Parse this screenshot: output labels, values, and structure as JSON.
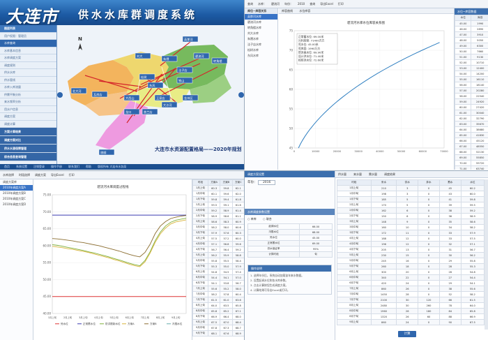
{
  "q1": {
    "brand": "大连市",
    "system_title": "供水水库群调度系统",
    "sidebar": [
      {
        "label": "图层列表",
        "kind": "hd"
      },
      {
        "label": "用户权限：管理员",
        "kind": ""
      },
      {
        "label": "水库查询",
        "kind": "act"
      },
      {
        "label": "水库基本信息",
        "kind": ""
      },
      {
        "label": "水库调度方案",
        "kind": ""
      },
      {
        "label": "调度规则",
        "kind": ""
      },
      {
        "label": "供水水库",
        "kind": ""
      },
      {
        "label": "供水管线",
        "kind": ""
      },
      {
        "label": "水库入库流量",
        "kind": ""
      },
      {
        "label": "供需平衡分析",
        "kind": ""
      },
      {
        "label": "来水频率分析",
        "kind": ""
      },
      {
        "label": "用水户信息",
        "kind": ""
      },
      {
        "label": "调度方案",
        "kind": ""
      },
      {
        "label": "调度计算",
        "kind": ""
      },
      {
        "label": "方案计算结果",
        "kind": "grp"
      },
      {
        "label": "调度方案对比",
        "kind": "grp"
      },
      {
        "label": "供水水源保障管理",
        "kind": "grp"
      },
      {
        "label": "综合信息查询管理",
        "kind": "grp"
      }
    ],
    "map_labels": [
      {
        "name": "英那河",
        "k": "a"
      },
      {
        "name": "碧流河",
        "k": "b"
      },
      {
        "name": "转角楼",
        "k": "c"
      },
      {
        "name": "朱隈",
        "k": "d"
      },
      {
        "name": "刘大",
        "k": "e"
      },
      {
        "name": "洼子店",
        "k": "f"
      },
      {
        "name": "松树",
        "k": "g"
      },
      {
        "name": "东风",
        "k": "h"
      },
      {
        "name": "铁山",
        "k": "i"
      },
      {
        "name": "大西山",
        "k": "j"
      },
      {
        "name": "王家店",
        "k": "k"
      },
      {
        "name": "金州区",
        "k": "l"
      },
      {
        "name": "旅顺",
        "k": "m"
      },
      {
        "name": "普兰店",
        "k": "n"
      },
      {
        "name": "大沙河",
        "k": "o"
      },
      {
        "name": "北大河",
        "k": "p"
      },
      {
        "name": "瓦房店",
        "k": "q"
      },
      {
        "name": "龙口",
        "k": "r"
      }
    ],
    "map_caption": "大连市水资源配置格局——2020年规划",
    "compass": "N",
    "status_items": [
      "首页",
      "系统设置",
      "注销登录",
      "操作手册",
      "联系我们",
      "帮助",
      "版权所有 大连市水务局"
    ]
  },
  "q2": {
    "toolbar": [
      "查询",
      "水库：",
      "碧流河",
      "年份：",
      "2010",
      "查询",
      "导出Excel",
      "打印"
    ],
    "tree_title": "库位~库容关系",
    "tree_items": [
      "英那河水库",
      "碧流河水库",
      "转角楼水库",
      "刘大水库",
      "朱隈水库",
      "洼子店水库",
      "松树水库",
      "东风水库"
    ],
    "tabs": [
      "库容曲线",
      "水位库容"
    ],
    "chart_title": "碧流河水库水位库容关系图",
    "legend_lines": [
      "正常蓄水位: 69.00米",
      "兴利库容: 71400万方",
      "死水位: 45.00米",
      "死库容: 1990万方",
      "防洪高水位: 69.90米",
      "设计洪水位: 71.40米",
      "校核洪水位: 72.60米"
    ],
    "table_title": "水位~库容数据",
    "table_headers": [
      "水位",
      "库容"
    ],
    "table_rows": [
      [
        "45.00",
        "1990"
      ],
      [
        "46.00",
        "2890"
      ],
      [
        "47.00",
        "3910"
      ],
      [
        "48.00",
        "5050"
      ],
      [
        "49.00",
        "6300"
      ],
      [
        "50.00",
        "7660"
      ],
      [
        "51.00",
        "9130"
      ],
      [
        "52.00",
        "10710"
      ],
      [
        "53.00",
        "12400"
      ],
      [
        "54.00",
        "14200"
      ],
      [
        "55.00",
        "16110"
      ],
      [
        "56.00",
        "18140"
      ],
      [
        "57.00",
        "20280"
      ],
      [
        "58.00",
        "22540"
      ],
      [
        "59.00",
        "24920"
      ],
      [
        "60.00",
        "27420"
      ],
      [
        "61.00",
        "30040"
      ],
      [
        "62.00",
        "32790"
      ],
      [
        "63.00",
        "35670"
      ],
      [
        "64.00",
        "38680"
      ],
      [
        "65.00",
        "41830"
      ],
      [
        "66.00",
        "45120"
      ],
      [
        "67.00",
        "48550"
      ],
      [
        "68.00",
        "52130"
      ],
      [
        "69.00",
        "55850"
      ],
      [
        "70.00",
        "59720"
      ],
      [
        "71.00",
        "63740"
      ],
      [
        "72.00",
        "67910"
      ]
    ]
  },
  "q3": {
    "toolbar": [
      "水库选择",
      "时段选择",
      "调度方案",
      "导出Excel",
      "打印"
    ],
    "tree_items": [
      "调度方案库",
      "2010年调度方案A",
      "2010年调度方案B",
      "2010年调度方案C",
      "2010年调度方案D"
    ],
    "chart_title": "碧流河水库调度过程线",
    "legend": [
      "死水位",
      "正常蓄水位",
      "防洪限制水位",
      "方案A",
      "方案B",
      "汛限水位"
    ],
    "table_headers": [
      "时段",
      "方案A",
      "方案B",
      "方案C"
    ],
    "table_rows": [
      [
        "1月上旬",
        "60.3",
        "59.8",
        "62.1"
      ],
      [
        "1月中旬",
        "60.1",
        "59.6",
        "62.0"
      ],
      [
        "1月下旬",
        "59.8",
        "59.4",
        "61.8"
      ],
      [
        "2月上旬",
        "59.5",
        "59.1",
        "61.6"
      ],
      [
        "2月中旬",
        "59.2",
        "58.9",
        "61.4"
      ],
      [
        "2月下旬",
        "58.9",
        "58.6",
        "61.1"
      ],
      [
        "3月上旬",
        "58.6",
        "58.3",
        "60.9"
      ],
      [
        "3月中旬",
        "58.2",
        "58.0",
        "60.6"
      ],
      [
        "3月下旬",
        "57.9",
        "57.6",
        "60.3"
      ],
      [
        "4月上旬",
        "57.5",
        "57.2",
        "60.0"
      ],
      [
        "4月中旬",
        "57.1",
        "56.8",
        "59.6"
      ],
      [
        "4月下旬",
        "56.7",
        "56.4",
        "59.2"
      ],
      [
        "5月上旬",
        "56.2",
        "55.9",
        "58.8"
      ],
      [
        "5月中旬",
        "55.8",
        "55.5",
        "58.4"
      ],
      [
        "5月下旬",
        "55.3",
        "55.0",
        "57.9"
      ],
      [
        "6月上旬",
        "54.8",
        "54.5",
        "57.4"
      ],
      [
        "6月中旬",
        "54.4",
        "54.1",
        "57.0"
      ],
      [
        "6月下旬",
        "54.1",
        "53.8",
        "56.7"
      ],
      [
        "7月上旬",
        "55.6",
        "55.2",
        "58.0"
      ],
      [
        "7月中旬",
        "58.2",
        "57.8",
        "60.4"
      ],
      [
        "7月下旬",
        "61.5",
        "61.0",
        "63.6"
      ],
      [
        "8月上旬",
        "64.0",
        "63.5",
        "65.8"
      ],
      [
        "8月中旬",
        "65.8",
        "65.2",
        "67.1"
      ],
      [
        "8月下旬",
        "66.9",
        "66.4",
        "68.0"
      ],
      [
        "9月上旬",
        "67.5",
        "67.0",
        "68.4"
      ],
      [
        "9月中旬",
        "67.8",
        "67.3",
        "68.7"
      ],
      [
        "9月下旬",
        "68.1",
        "67.6",
        "68.9"
      ]
    ]
  },
  "q4": {
    "tabs": [
      "供水量",
      "来水量",
      "需水量",
      "调度结果"
    ],
    "panel_title": "调度方案设置",
    "year_label": "年份：",
    "year_value": "2016",
    "section_title": "水库调度参数设置",
    "options": [
      "单库",
      "联合"
    ],
    "params": [
      [
        "起调水位",
        "66.00"
      ],
      [
        "汛限水位",
        "68.00"
      ],
      [
        "死水位",
        "45.00"
      ],
      [
        "正常蓄水位",
        "69.00"
      ],
      [
        "供水保证率",
        "95%"
      ],
      [
        "计算时段",
        "旬"
      ]
    ],
    "note_title": "操作说明",
    "notes": [
      "1. 选择年份后，系统自动加载该年来水数据。",
      "2. 设置起调水位和各水库参数。",
      "3. 点击计算按钮生成调度方案。",
      "4. 计算结果可导出Excel或打印。"
    ],
    "table_headers": [
      "时段",
      "来水",
      "供水",
      "弃水",
      "蓄水",
      "水位"
    ],
    "table_rows": [
      [
        "1月上旬",
        "210",
        "3",
        "0",
        "45",
        "60.2"
      ],
      [
        "1月中旬",
        "198",
        "3",
        "0",
        "43",
        "60.0"
      ],
      [
        "1月下旬",
        "185",
        "5",
        "0",
        "41",
        "59.8"
      ],
      [
        "2月上旬",
        "170",
        "5",
        "0",
        "39",
        "59.5"
      ],
      [
        "2月中旬",
        "162",
        "6",
        "0",
        "38",
        "59.2"
      ],
      [
        "2月下旬",
        "150",
        "6",
        "0",
        "36",
        "58.9"
      ],
      [
        "3月上旬",
        "148",
        "9",
        "0",
        "35",
        "58.6"
      ],
      [
        "3月中旬",
        "160",
        "10",
        "0",
        "34",
        "58.2"
      ],
      [
        "3月下旬",
        "172",
        "11",
        "0",
        "33",
        "57.9"
      ],
      [
        "4月上旬",
        "188",
        "12",
        "0",
        "33",
        "57.5"
      ],
      [
        "4月中旬",
        "196",
        "12",
        "0",
        "32",
        "57.1"
      ],
      [
        "4月下旬",
        "205",
        "13",
        "0",
        "31",
        "56.7"
      ],
      [
        "5月上旬",
        "230",
        "15",
        "0",
        "30",
        "56.2"
      ],
      [
        "5月中旬",
        "245",
        "16",
        "0",
        "29",
        "55.8"
      ],
      [
        "5月下旬",
        "260",
        "18",
        "0",
        "28",
        "55.3"
      ],
      [
        "6月上旬",
        "300",
        "20",
        "0",
        "28",
        "54.8"
      ],
      [
        "6月中旬",
        "340",
        "22",
        "0",
        "27",
        "54.4"
      ],
      [
        "6月下旬",
        "420",
        "24",
        "0",
        "29",
        "54.1"
      ],
      [
        "7月上旬",
        "860",
        "26",
        "0",
        "38",
        "55.6"
      ],
      [
        "7月中旬",
        "1450",
        "28",
        "0",
        "52",
        "58.2"
      ],
      [
        "7月下旬",
        "2100",
        "30",
        "120",
        "66",
        "61.5"
      ],
      [
        "8月上旬",
        "2480",
        "30",
        "260",
        "78",
        "64.0"
      ],
      [
        "8月中旬",
        "1960",
        "28",
        "180",
        "84",
        "65.8"
      ],
      [
        "8月下旬",
        "1320",
        "26",
        "60",
        "88",
        "66.9"
      ],
      [
        "9月上旬",
        "860",
        "24",
        "0",
        "90",
        "67.5"
      ]
    ],
    "button": "计算"
  }
}
